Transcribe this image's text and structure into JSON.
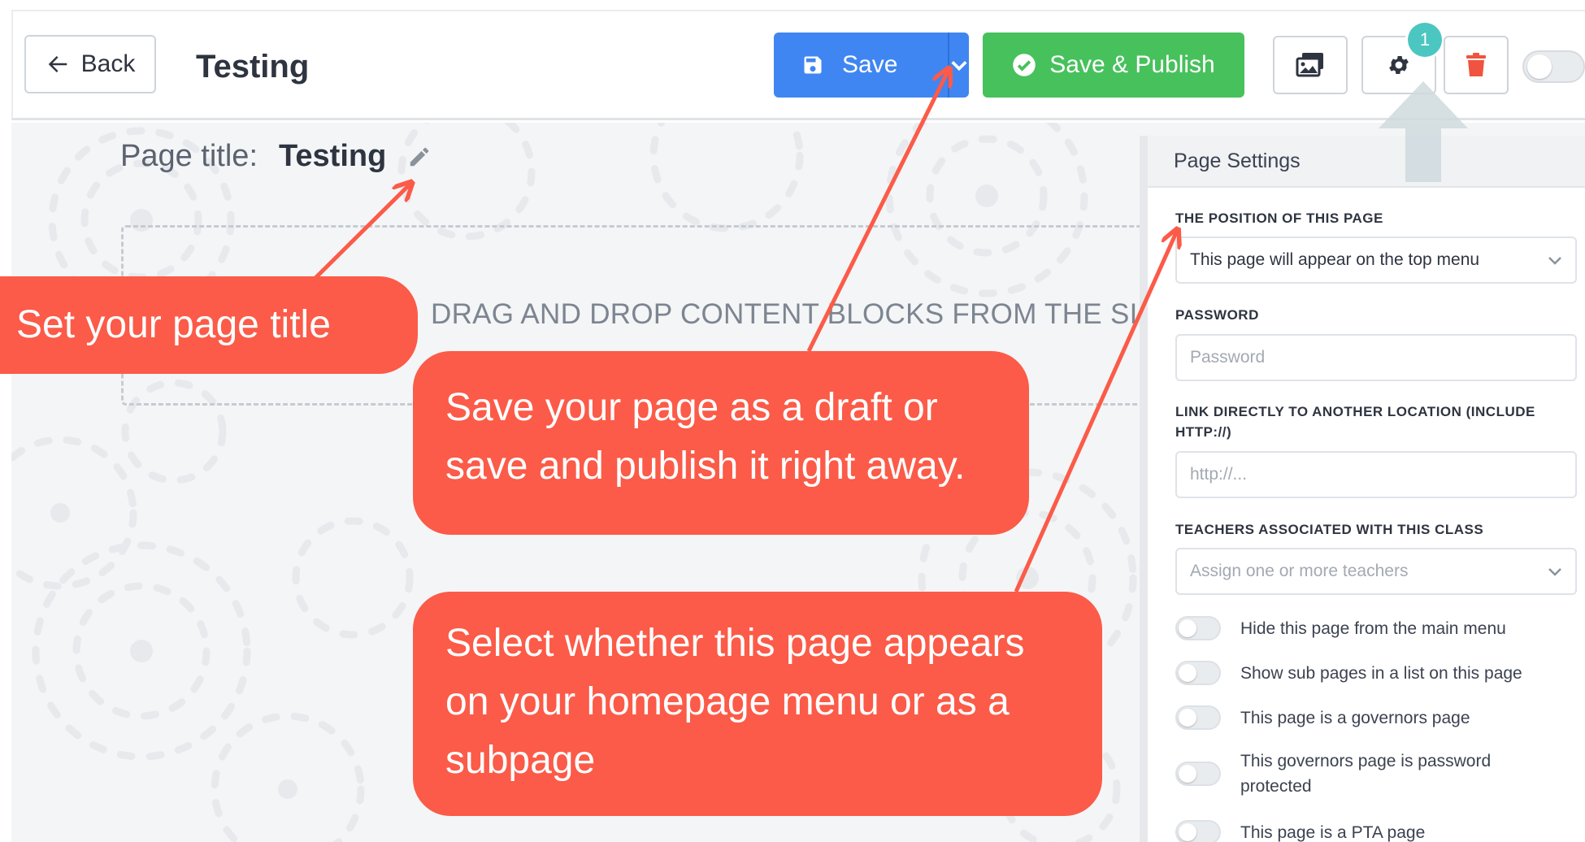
{
  "topbar": {
    "back_label": "Back",
    "app_title": "Testing",
    "save_label": "Save",
    "publish_label": "Save & Publish",
    "notification_count": "1"
  },
  "canvas": {
    "page_title_label": "Page title:",
    "page_title_value": "Testing",
    "dropzone_text": "DRAG AND DROP CONTENT BLOCKS FROM THE SIDE B"
  },
  "settings": {
    "header": "Page Settings",
    "position_label": "THE POSITION OF THIS PAGE",
    "position_value": "This page will appear on the top menu",
    "password_label": "PASSWORD",
    "password_placeholder": "Password",
    "link_label": "LINK DIRECTLY TO ANOTHER LOCATION (INCLUDE HTTP://)",
    "link_placeholder": "http://...",
    "teachers_label": "TEACHERS ASSOCIATED WITH THIS CLASS",
    "teachers_placeholder": "Assign one or more teachers",
    "toggles": [
      {
        "label": "Hide this page from the main menu",
        "on": false
      },
      {
        "label": "Show sub pages in a list on this page",
        "on": false
      },
      {
        "label": "This page is a governors page",
        "on": false
      },
      {
        "label": "This governors page is password protected",
        "on": false
      },
      {
        "label": "This page is a PTA page",
        "on": false
      }
    ]
  },
  "callouts": {
    "title_tip": "Set your page title",
    "save_tip": "Save your page as a draft or save and publish it right away.",
    "position_tip": "Select whether this page appears on your homepage menu or as a subpage"
  },
  "colors": {
    "save_blue": "#3f86f2",
    "publish_green": "#47c15c",
    "delete_red": "#f0533f",
    "callout_red": "#fb5b48",
    "badge_teal": "#4cc6c0"
  },
  "icons": [
    "arrow-left-icon",
    "floppy-disk-icon",
    "chevron-down-icon",
    "check-circle-icon",
    "images-icon",
    "gear-icon",
    "trash-icon",
    "pencil-icon"
  ]
}
